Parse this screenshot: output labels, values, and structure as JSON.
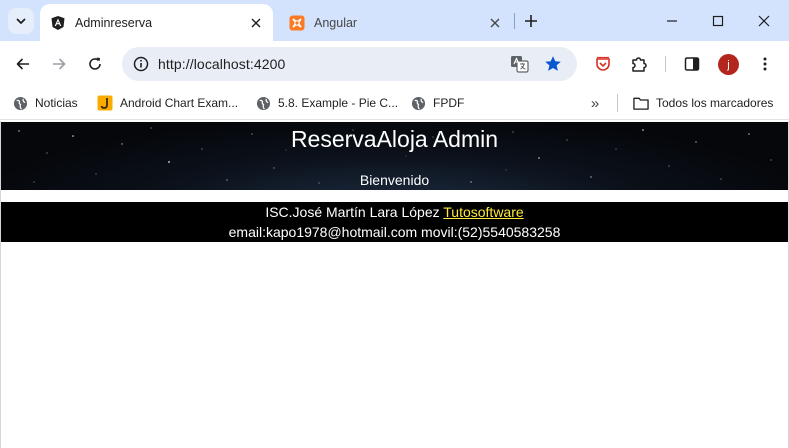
{
  "browser": {
    "tabs": [
      {
        "title": "Adminreserva",
        "active": true,
        "favicon": "angular-icon"
      },
      {
        "title": "Angular",
        "active": false,
        "favicon": "xampp-icon"
      }
    ],
    "address_bar": {
      "url": "http://localhost:4200"
    },
    "bookmarks": [
      {
        "label": "Noticias",
        "icon": "globe-icon"
      },
      {
        "label": "Android Chart Exam...",
        "icon": "bookmark-j-icon"
      },
      {
        "label": "5.8. Example - Pie C...",
        "icon": "globe-icon"
      },
      {
        "label": "FPDF",
        "icon": "globe-icon"
      }
    ],
    "all_bookmarks_label": "Todos los marcadores",
    "profile_initial": "j",
    "colors": {
      "tab_strip": "#d3e3fd",
      "omnibox": "#e9eef6",
      "star": "#0b57d0",
      "avatar": "#b3261e"
    }
  },
  "page": {
    "title": "ReservaAloja Admin",
    "welcome": "Bienvenido",
    "footer": {
      "author": "ISC.José Martín Lara López",
      "link_text": "Tutosoftware",
      "contact": "email:kapo1978@hotmail.com movil:(52)5540583258"
    },
    "colors": {
      "link": "#ffeb3b",
      "bar": "#000000"
    }
  }
}
